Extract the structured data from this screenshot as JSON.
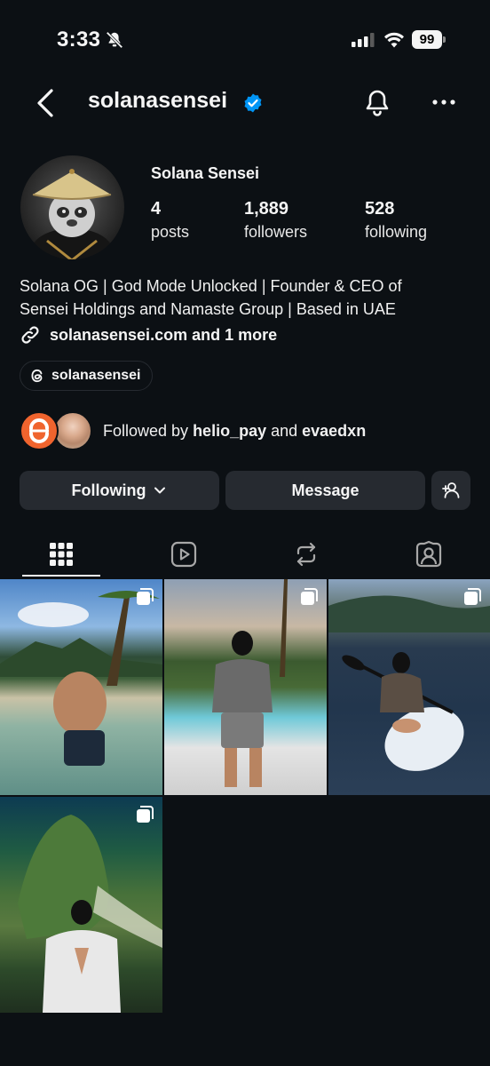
{
  "status_bar": {
    "time": "3:33",
    "battery": "99"
  },
  "header": {
    "username": "solanasensei"
  },
  "profile": {
    "display_name": "Solana Sensei",
    "stats": [
      {
        "value": "4",
        "label": "posts"
      },
      {
        "value": "1,889",
        "label": "followers"
      },
      {
        "value": "528",
        "label": "following"
      }
    ],
    "bio_line1": "Solana OG | God Mode Unlocked | Founder & CEO of",
    "bio_line2": "Sensei Holdings and Namaste Group | Based in UAE",
    "link": "solanasensei.com and 1 more",
    "threads_handle": "solanasensei"
  },
  "followed_by": {
    "prefix": "Followed by ",
    "user1": "helio_pay",
    "joiner": " and ",
    "user2": "evaedxn"
  },
  "actions": {
    "following": "Following",
    "message": "Message"
  },
  "tabs": [
    "grid",
    "reels",
    "reposts",
    "tagged"
  ],
  "posts_count_shown": 4,
  "colors": {
    "background": "#0c1014",
    "button": "#262a30",
    "verified": "#0095f6",
    "text": "#f5f5f5"
  }
}
